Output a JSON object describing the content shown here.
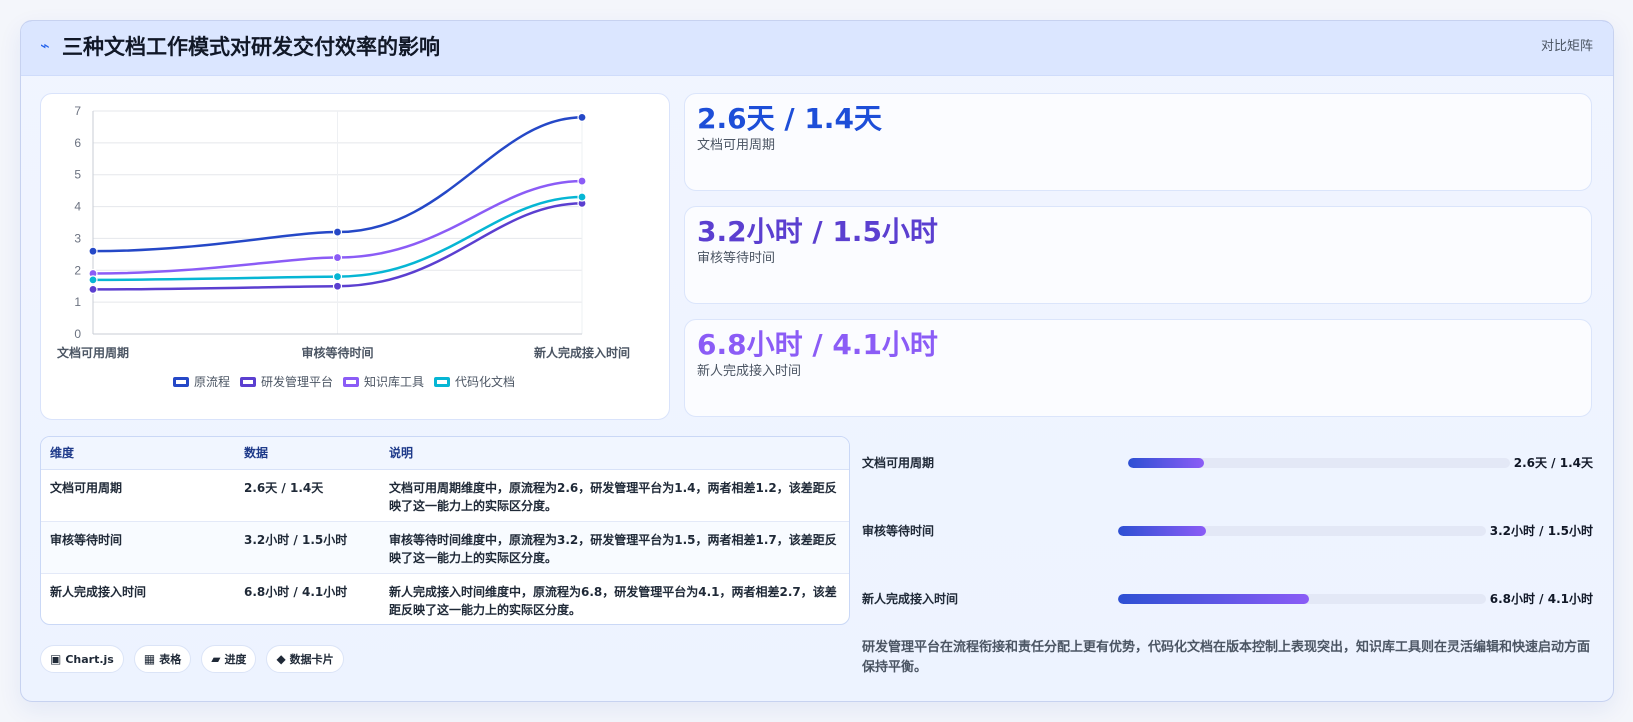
{
  "header": {
    "icon": "lightning-icon",
    "title": "三种文档工作模式对研发交付效率的影响",
    "tag": "对比矩阵"
  },
  "chart_data": {
    "type": "line",
    "categories": [
      "文档可用周期",
      "审核等待时间",
      "新人完成接入时间"
    ],
    "ylim": [
      0,
      7
    ],
    "yticks": [
      0,
      1,
      2,
      3,
      4,
      5,
      6,
      7
    ],
    "grid": true,
    "legend_position": "bottom",
    "series": [
      {
        "name": "原流程",
        "values": [
          2.6,
          3.2,
          6.8
        ],
        "color": "#2548c7"
      },
      {
        "name": "研发管理平台",
        "values": [
          1.4,
          1.5,
          4.1
        ],
        "color": "#5b3fd0"
      },
      {
        "name": "知识库工具",
        "values": [
          1.9,
          2.4,
          4.8
        ],
        "color": "#8b5cf6"
      },
      {
        "name": "代码化文档",
        "values": [
          1.7,
          1.8,
          4.3
        ],
        "color": "#06b6d4"
      }
    ]
  },
  "kpis": [
    {
      "value": "2.6天 / 1.4天",
      "label": "文档可用周期",
      "color": "#1d4ed8"
    },
    {
      "value": "3.2小时 / 1.5小时",
      "label": "审核等待时间",
      "color": "#5b3fd0"
    },
    {
      "value": "6.8小时 / 4.1小时",
      "label": "新人完成接入时间",
      "color": "#8b5cf6"
    }
  ],
  "table": {
    "headers": [
      "维度",
      "数据",
      "说明"
    ],
    "rows": [
      [
        "文档可用周期",
        "2.6天 / 1.4天",
        "文档可用周期维度中，原流程为2.6，研发管理平台为1.4，两者相差1.2，该差距反映了这一能力上的实际区分度。"
      ],
      [
        "审核等待时间",
        "3.2小时 / 1.5小时",
        "审核等待时间维度中，原流程为3.2，研发管理平台为1.5，两者相差1.7，该差距反映了这一能力上的实际区分度。"
      ],
      [
        "新人完成接入时间",
        "6.8小时 / 4.1小时",
        "新人完成接入时间维度中，原流程为6.8，研发管理平台为4.1，两者相差2.7，该差距反映了这一能力上的实际区分度。"
      ]
    ]
  },
  "progress": [
    {
      "label": "文档可用周期",
      "value": "2.6天 / 1.4天",
      "fill": 0.2
    },
    {
      "label": "审核等待时间",
      "value": "3.2小时 / 1.5小时",
      "fill": 0.24
    },
    {
      "label": "新人完成接入时间",
      "value": "6.8小时 / 4.1小时",
      "fill": 0.52
    }
  ],
  "summary": "研发管理平台在流程衔接和责任分配上更有优势，代码化文档在版本控制上表现突出，知识库工具则在灵活编辑和快速启动方面保持平衡。",
  "chips": [
    {
      "icon": "chart-icon",
      "icon_glyph": "▣",
      "label": "Chart.js"
    },
    {
      "icon": "table-icon",
      "icon_glyph": "▦",
      "label": "表格"
    },
    {
      "icon": "progress-icon",
      "icon_glyph": "▰",
      "label": "进度"
    },
    {
      "icon": "card-icon",
      "icon_glyph": "◆",
      "label": "数据卡片"
    }
  ]
}
